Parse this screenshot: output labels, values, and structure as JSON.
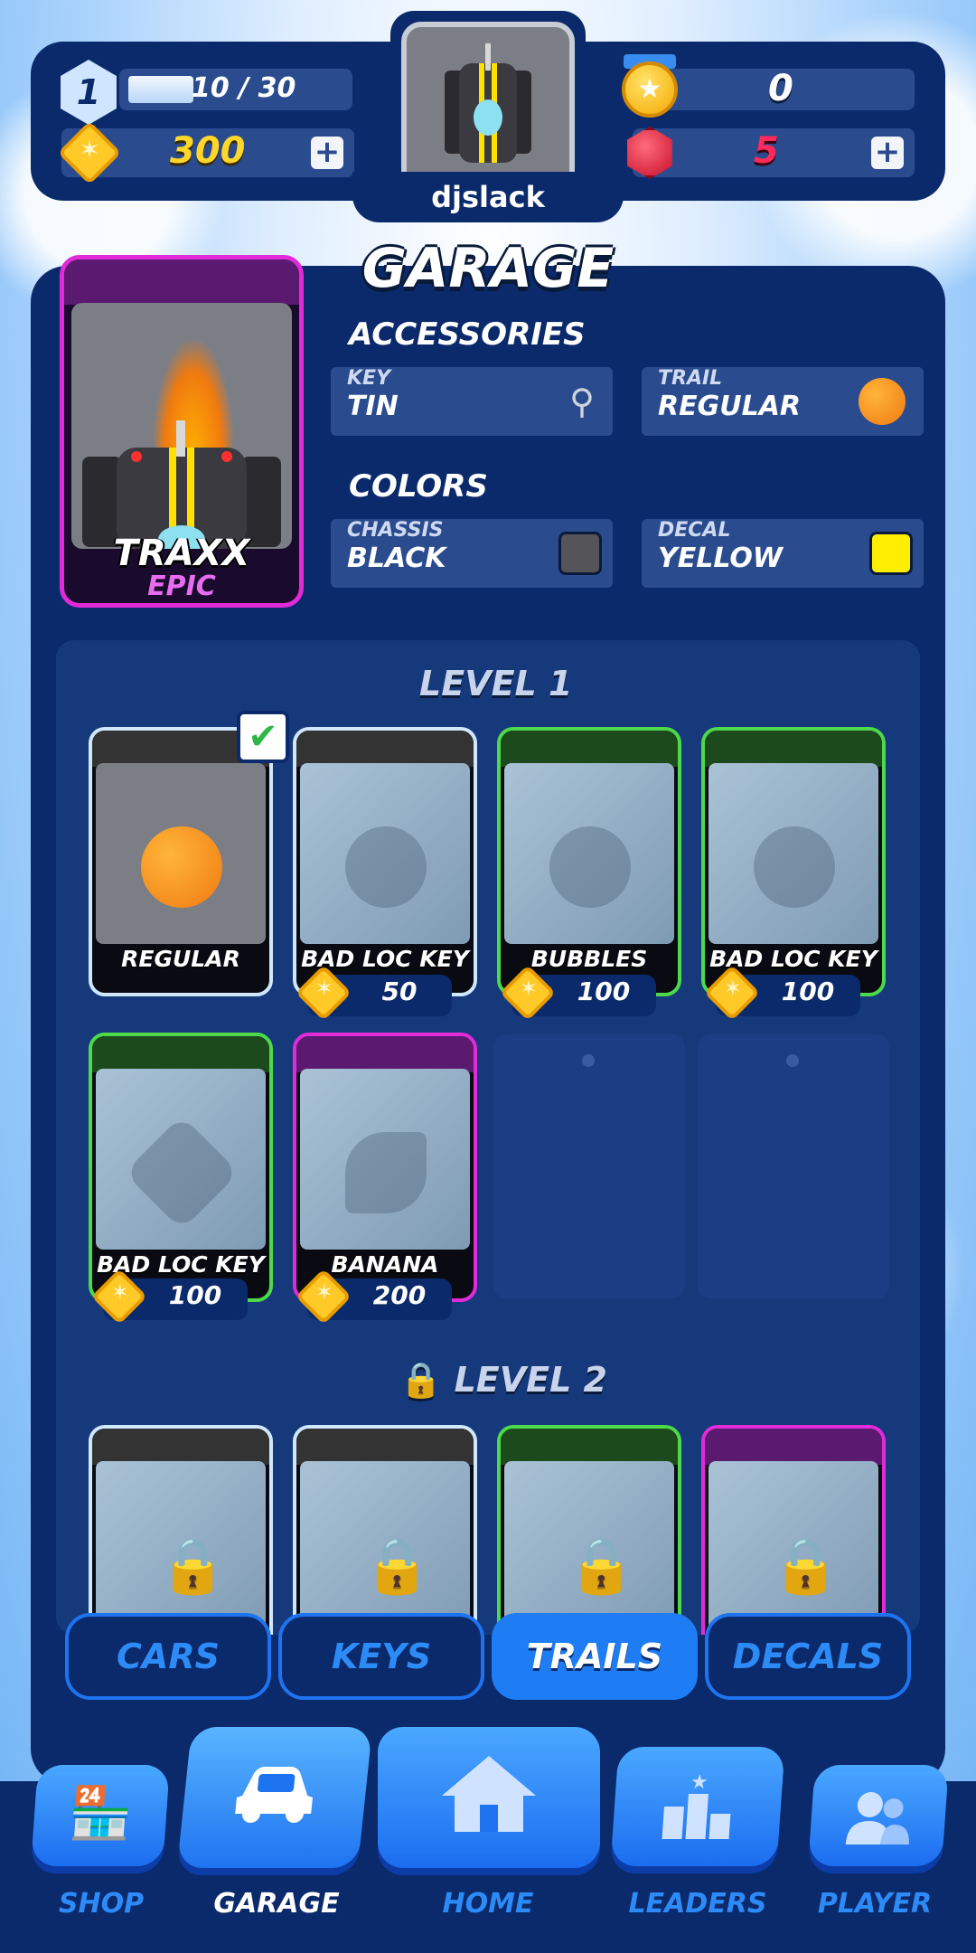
{
  "hud": {
    "level": "1",
    "xp_text": "10 / 30",
    "coins": "300",
    "player_name": "djslack",
    "stars": "0",
    "gems": "5",
    "plus": "+"
  },
  "garage": {
    "title": "GARAGE",
    "car_name": "TRAXX",
    "car_rarity": "EPIC",
    "accessories_heading": "ACCESSORIES",
    "key_label": "KEY",
    "key_value": "TIN",
    "trail_label": "TRAIL",
    "trail_value": "REGULAR",
    "colors_heading": "COLORS",
    "chassis_label": "CHASSIS",
    "chassis_value": "BLACK",
    "decal_label": "DECAL",
    "decal_value": "YELLOW",
    "chassis_color": "#555559",
    "decal_color": "#ffee00"
  },
  "levels": {
    "level1": "LEVEL 1",
    "level2": "LEVEL 2"
  },
  "items_level1": [
    {
      "label": "REGULAR",
      "price": "",
      "rarity_color": "#d0e8ff",
      "selected": true
    },
    {
      "label": "BAD LOC KEY",
      "price": "50",
      "rarity_color": "#d0e8ff"
    },
    {
      "label": "BUBBLES",
      "price": "100",
      "rarity_color": "#4cd94a"
    },
    {
      "label": "BAD LOC KEY",
      "price": "100",
      "rarity_color": "#4cd94a"
    },
    {
      "label": "BAD LOC KEY",
      "price": "100",
      "rarity_color": "#4cd94a"
    },
    {
      "label": "BANANA",
      "price": "200",
      "rarity_color": "#e12bd8"
    }
  ],
  "tabs": {
    "cars": "CARS",
    "keys": "KEYS",
    "trails": "TRAILS",
    "decals": "DECALS"
  },
  "nav": {
    "shop": "SHOP",
    "garage": "GARAGE",
    "home": "HOME",
    "leaders": "LEADERS",
    "player": "PLAYER"
  },
  "icons": {
    "check": "✔",
    "lock": "🔒"
  }
}
